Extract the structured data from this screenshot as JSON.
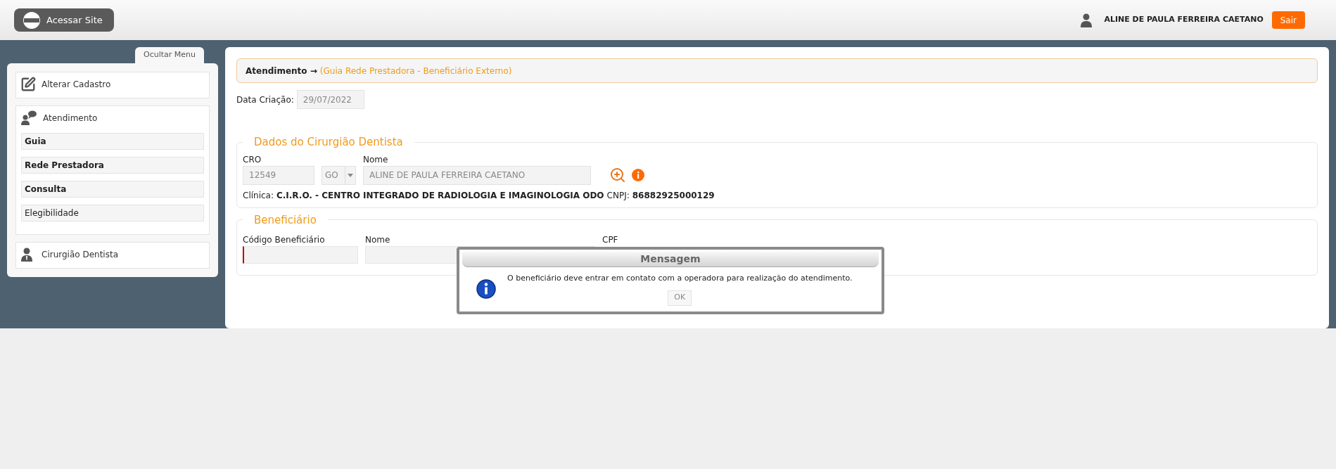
{
  "header": {
    "site_button": "Acessar Site",
    "user_name": "ALINE DE PAULA FERREIRA CAETANO",
    "logout_button": "Sair"
  },
  "sidebar": {
    "toggle_tab": "Ocultar Menu",
    "items": [
      {
        "label": "Alterar Cadastro",
        "kind": "edit"
      },
      {
        "label": "Atendimento",
        "kind": "chat",
        "children": [
          {
            "label": "Guia",
            "bold": true
          },
          {
            "label": "Rede Prestadora",
            "bold": true
          },
          {
            "label": "Consulta",
            "bold": true
          },
          {
            "label": "Elegibilidade",
            "bold": false
          }
        ]
      },
      {
        "label": "Cirurgião Dentista",
        "kind": "person"
      }
    ]
  },
  "breadcrumb": {
    "section": "Atendimento →",
    "page": "(Guia Rede Prestadora - Beneficiário Externo)"
  },
  "creation_date": {
    "label": "Data Criação:",
    "value": "29/07/2022"
  },
  "dentist_section": {
    "legend": "Dados do Cirurgião Dentista",
    "cro": {
      "label": "CRO",
      "value": "12549"
    },
    "state": {
      "value": "GO"
    },
    "name": {
      "label": "Nome",
      "value": "ALINE DE PAULA FERREIRA CAETANO"
    },
    "clinic_label": "Clínica:",
    "clinic_value": "C.I.R.O. - CENTRO INTEGRADO DE RADIOLOGIA E IMAGINOLOGIA ODO",
    "cnpj_label": "CNPJ:",
    "cnpj_value": "86882925000129"
  },
  "beneficiary_section": {
    "legend": "Beneficiário",
    "fields": [
      {
        "label": "Código Beneficiário",
        "error": true
      },
      {
        "label": "Nome",
        "error": false
      },
      {
        "label": "CPF"
      }
    ]
  },
  "dialog": {
    "title": "Mensagem",
    "message": "O beneficiário deve entrar em contato com a operadora para realização do atendimento.",
    "ok_button": "OK"
  }
}
